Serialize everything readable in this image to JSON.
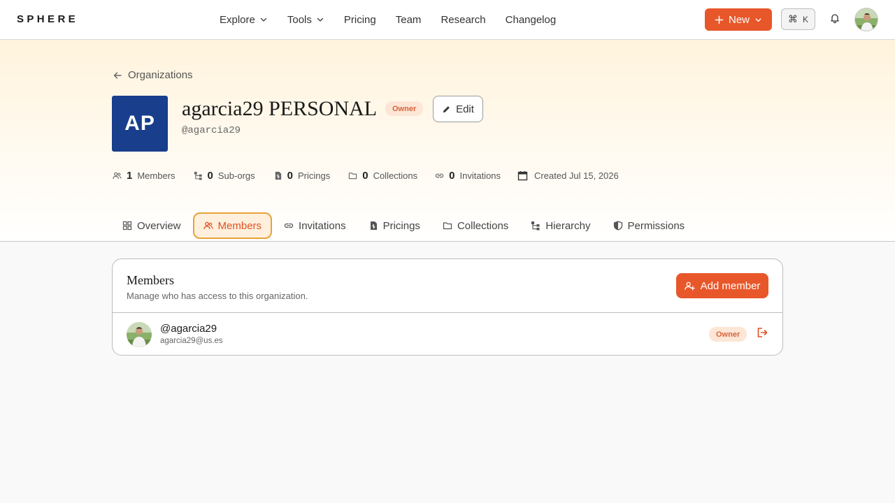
{
  "brand": {
    "name": "SPHERE"
  },
  "nav": [
    {
      "label": "Explore",
      "dropdown": true
    },
    {
      "label": "Tools",
      "dropdown": true
    },
    {
      "label": "Pricing",
      "dropdown": false
    },
    {
      "label": "Team",
      "dropdown": false
    },
    {
      "label": "Research",
      "dropdown": false
    },
    {
      "label": "Changelog",
      "dropdown": false
    }
  ],
  "header": {
    "new_label": "New",
    "shortcut_cmd": "⌘",
    "shortcut_key": "K"
  },
  "org": {
    "back_label": "Organizations",
    "initials": "AP",
    "name": "agarcia29 PERSONAL",
    "role_badge": "Owner",
    "edit_label": "Edit",
    "handle": "@agarcia29"
  },
  "stats": {
    "members": {
      "count": "1",
      "label": "Members"
    },
    "suborgs": {
      "count": "0",
      "label": "Sub-orgs"
    },
    "pricings": {
      "count": "0",
      "label": "Pricings"
    },
    "collections": {
      "count": "0",
      "label": "Collections"
    },
    "invitations": {
      "count": "0",
      "label": "Invitations"
    },
    "created": "Created Jul 15, 2026"
  },
  "tabs": [
    {
      "label": "Overview",
      "icon": "grid-icon",
      "active": false
    },
    {
      "label": "Members",
      "icon": "users-icon",
      "active": true
    },
    {
      "label": "Invitations",
      "icon": "link-icon",
      "active": false
    },
    {
      "label": "Pricings",
      "icon": "file-dollar-icon",
      "active": false
    },
    {
      "label": "Collections",
      "icon": "folder-icon",
      "active": false
    },
    {
      "label": "Hierarchy",
      "icon": "hierarchy-icon",
      "active": false
    },
    {
      "label": "Permissions",
      "icon": "shield-icon",
      "active": false
    }
  ],
  "members_card": {
    "title": "Members",
    "subtitle": "Manage who has access to this organization.",
    "add_label": "Add member",
    "members": [
      {
        "handle": "@agarcia29",
        "email": "agarcia29@us.es",
        "role": "Owner"
      }
    ]
  },
  "colors": {
    "accent": "#e8572a",
    "org_avatar": "#183e8c",
    "badge_bg": "#fde6d6",
    "badge_text": "#d9643a",
    "active_tab_border": "#e8a23a"
  }
}
